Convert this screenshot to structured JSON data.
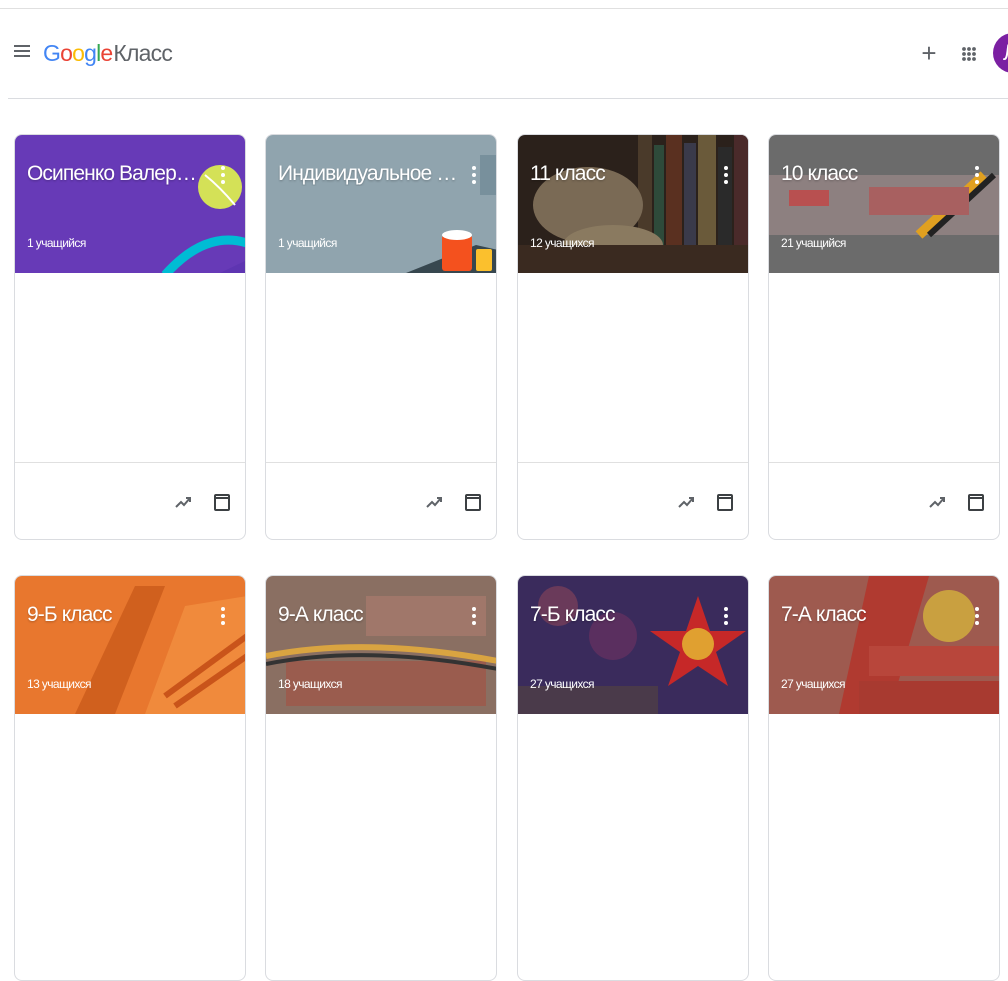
{
  "header": {
    "logo_letters": [
      {
        "ch": "G",
        "color": "#4285F4"
      },
      {
        "ch": "o",
        "color": "#EA4335"
      },
      {
        "ch": "o",
        "color": "#FBBC05"
      },
      {
        "ch": "g",
        "color": "#4285F4"
      },
      {
        "ch": "l",
        "color": "#34A853"
      },
      {
        "ch": "e",
        "color": "#EA4335"
      }
    ],
    "product_name": "Класс",
    "add_symbol": "+",
    "avatar_letter": "Л",
    "avatar_color": "#7b1fa2"
  },
  "icons": {
    "menu": "menu-icon",
    "add": "plus-icon",
    "apps": "apps-grid-icon",
    "more": "more-vert-icon",
    "trend": "trending-up-icon",
    "folder": "folder-icon"
  },
  "classes": [
    {
      "title": "Осипенко Валерий, ...",
      "students": "1 учащийся",
      "banner": "purple-tennis",
      "color": "#673ab7"
    },
    {
      "title": "Индивидуальное об...",
      "students": "1 учащийся",
      "banner": "grey-cup",
      "color": "#90a4ae"
    },
    {
      "title": "11 класс",
      "students": "12 учащихся",
      "banner": "cat-books",
      "color": "#3e2f26"
    },
    {
      "title": "10 класс",
      "students": "21 учащийся",
      "banner": "pobeda-1945",
      "color": "#6d6d6d"
    },
    {
      "title": "9-Б класс",
      "students": "13 учащихся",
      "banner": "orange-75",
      "color": "#e8772e"
    },
    {
      "title": "9-А класс",
      "students": "18 учащихся",
      "banner": "pobeda-2020",
      "color": "#8a6f62"
    },
    {
      "title": "7-Б класс",
      "students": "27 учащихся",
      "banner": "fireworks-star",
      "color": "#3a2b5c"
    },
    {
      "title": "7-А класс",
      "students": "27 учащихся",
      "banner": "red-75",
      "color": "#9e5a4f"
    }
  ]
}
